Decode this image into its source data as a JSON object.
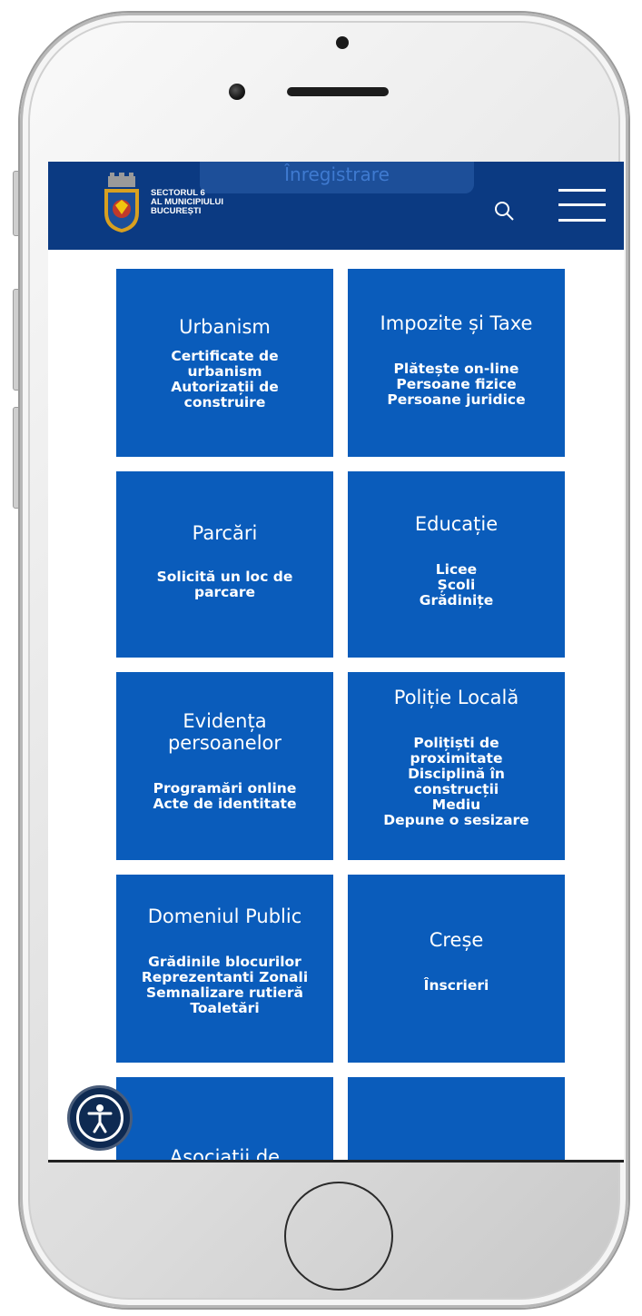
{
  "header": {
    "register_tab": "Înregistrare",
    "brand_lines": [
      "SECTORUL 6",
      "AL MUNICIPIULUI",
      "BUCUREȘTI"
    ],
    "colors": {
      "header_bg": "#0b3a82",
      "tile_bg": "#0a5cbb"
    }
  },
  "tiles": [
    {
      "title": "Urbanism",
      "lines": [
        "Certificate de",
        "urbanism",
        "Autorizații de",
        "construire"
      ]
    },
    {
      "title": "Impozite și Taxe",
      "lines": [
        "Plătește on-line",
        "Persoane fizice",
        "Persoane juridice"
      ]
    },
    {
      "title": "Parcări",
      "lines": [
        "Solicită un loc de",
        "parcare"
      ]
    },
    {
      "title": "Educație",
      "lines": [
        "Licee",
        "Școli",
        "Grădinițe"
      ]
    },
    {
      "title": "Evidența persoanelor",
      "lines": [
        "Programări online",
        "Acte de identitate"
      ]
    },
    {
      "title": "Poliție Locală",
      "lines": [
        "Polițiști de",
        "proximitate",
        "Disciplină în",
        "construcții",
        "Mediu",
        "Depune o sesizare"
      ]
    },
    {
      "title": "Domeniul Public",
      "lines": [
        "Grădinile blocurilor",
        "Reprezentanti Zonali",
        "Semnalizare rutieră",
        "Toaletări"
      ]
    },
    {
      "title": "Creșe",
      "lines": [
        "Înscrieri"
      ]
    },
    {
      "title": "Asociații de",
      "lines": []
    },
    {
      "title": "",
      "lines": []
    }
  ],
  "icons": [
    "crest-logo",
    "search-icon",
    "hamburger-menu-icon",
    "accessibility-icon"
  ]
}
